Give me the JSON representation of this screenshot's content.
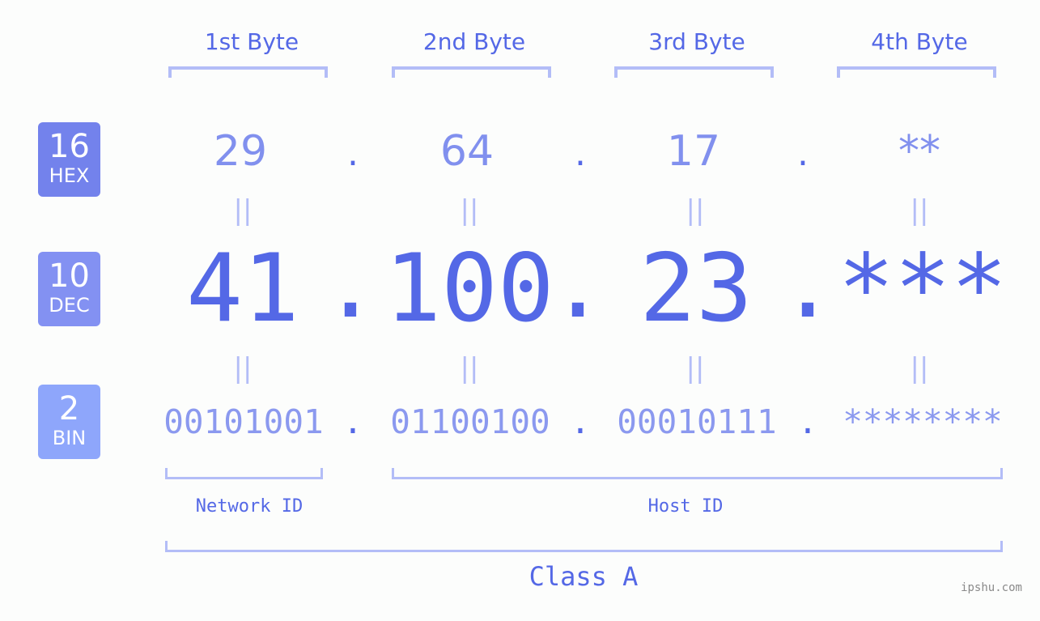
{
  "colors": {
    "accent": "#5468e6",
    "hex_value": "#8190ee",
    "bin_value": "#8b99ef",
    "bracket": "#b3bdf7",
    "badge_hex": "#7382ec",
    "badge_dec": "#8391f2",
    "badge_bin": "#8ea6fb",
    "watermark": "#8a8a8a"
  },
  "byte_headers": [
    "1st Byte",
    "2nd Byte",
    "3rd Byte",
    "4th Byte"
  ],
  "badges": {
    "hex": {
      "num": "16",
      "label": "HEX"
    },
    "dec": {
      "num": "10",
      "label": "DEC"
    },
    "bin": {
      "num": "2",
      "label": "BIN"
    }
  },
  "hex_values": [
    "29",
    "64",
    "17",
    "**"
  ],
  "dec_values": [
    "41",
    "100",
    "23",
    "***"
  ],
  "bin_values": [
    "00101001",
    "01100100",
    "00010111",
    "********"
  ],
  "separator": ".",
  "equals_sign": "=",
  "parts": {
    "network": "Network ID",
    "host": "Host ID"
  },
  "class_label": "Class A",
  "watermark": "ipshu.com"
}
